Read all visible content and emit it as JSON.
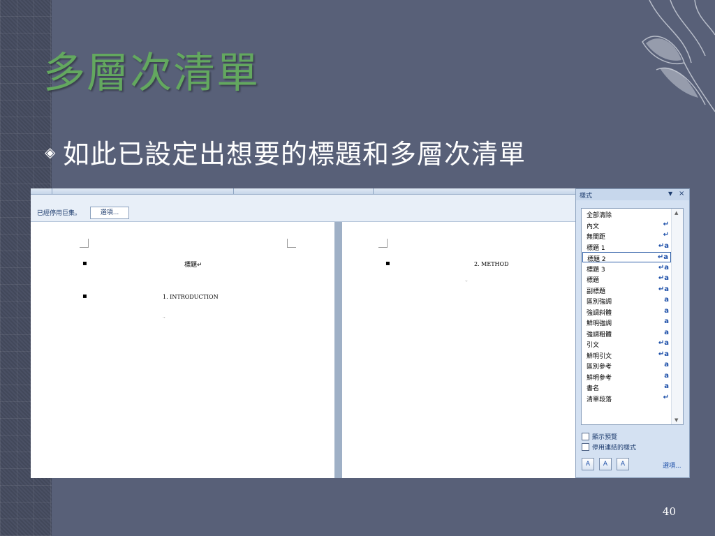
{
  "slide": {
    "title": "多層次清單",
    "bullet_icon": "◈",
    "bullet_text": "如此已設定出想要的標題和多層次清單",
    "page_number": "40"
  },
  "word": {
    "macro_bar": {
      "message": "已經停用巨集。",
      "options_button": "選項..."
    },
    "left_page": {
      "heading": "標題↵",
      "list_item": "1.  INTRODUCTION",
      "para_mark": ".,"
    },
    "right_page": {
      "list_item": "2.  METHOD",
      "para_mark": ".,"
    },
    "styles_pane": {
      "title": "樣式",
      "dropdown_icon": "▼",
      "close_icon": "×",
      "items": [
        {
          "name": "全部清除",
          "glyph": ""
        },
        {
          "name": "內文",
          "glyph": "↵"
        },
        {
          "name": "無間距",
          "glyph": "↵"
        },
        {
          "name": "標題 1",
          "glyph": "↵a"
        },
        {
          "name": "標題 2",
          "glyph": "↵a"
        },
        {
          "name": "標題 3",
          "glyph": "↵a"
        },
        {
          "name": "標題",
          "glyph": "↵a"
        },
        {
          "name": "副標題",
          "glyph": "↵a"
        },
        {
          "name": "區別強調",
          "glyph": "a"
        },
        {
          "name": "強調斜體",
          "glyph": "a"
        },
        {
          "name": "鮮明強調",
          "glyph": "a"
        },
        {
          "name": "強調粗體",
          "glyph": "a"
        },
        {
          "name": "引文",
          "glyph": "↵a"
        },
        {
          "name": "鮮明引文",
          "glyph": "↵a"
        },
        {
          "name": "區別參考",
          "glyph": "a"
        },
        {
          "name": "鮮明參考",
          "glyph": "a"
        },
        {
          "name": "書名",
          "glyph": "a"
        },
        {
          "name": "清單段落",
          "glyph": "↵"
        }
      ],
      "selected_index": 4,
      "show_preview": "顯示預覽",
      "disable_linked": "停用連結的樣式",
      "options_link": "選項..."
    }
  }
}
